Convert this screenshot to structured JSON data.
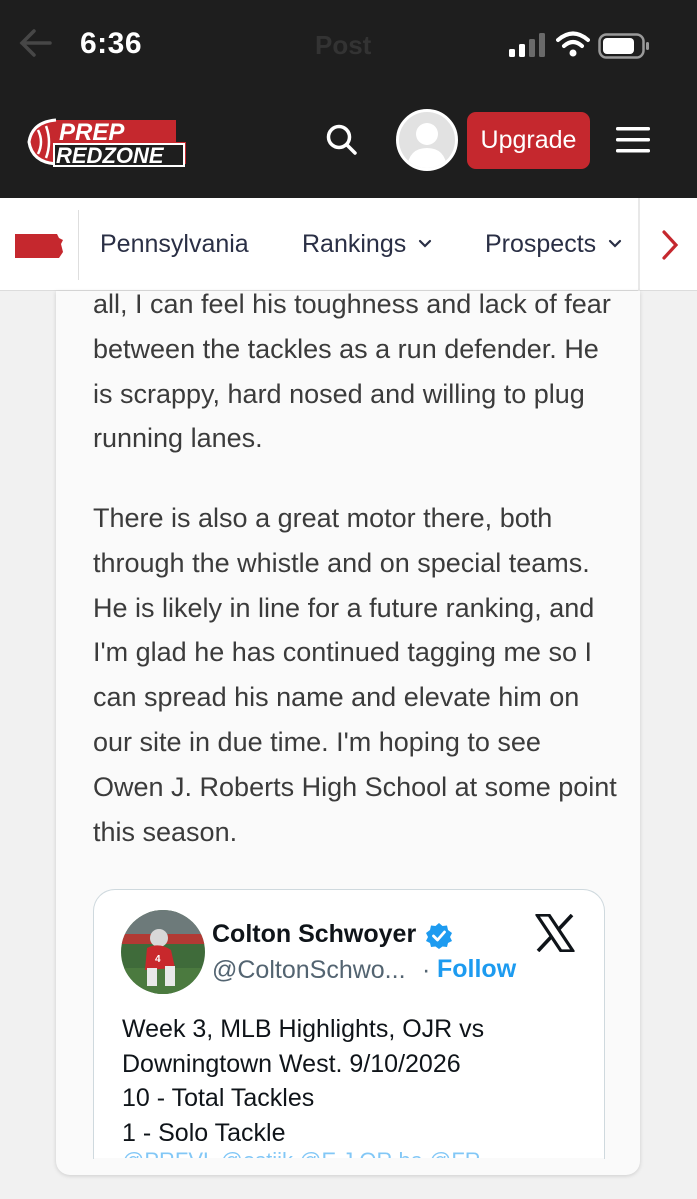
{
  "status_bar": {
    "time": "6:36",
    "ghost_title": "Post",
    "icons": [
      "back-arrow-icon",
      "cell-signal-icon",
      "wifi-icon",
      "battery-icon"
    ]
  },
  "header": {
    "logo_line1": "PREP",
    "logo_line2": "REDZONE",
    "upgrade_label": "Upgrade",
    "icons": [
      "search-icon",
      "avatar-icon",
      "hamburger-menu-icon"
    ],
    "colors": {
      "bg": "#1e1e1e",
      "brand_red": "#c5282e"
    }
  },
  "sub_nav": {
    "items": [
      {
        "label": "Pennsylvania"
      },
      {
        "label": "Rankings"
      },
      {
        "label": "Prospects"
      }
    ],
    "icons": [
      "pennsylvania-flag-icon",
      "chevron-down-icon",
      "chevron-right-icon"
    ]
  },
  "article": {
    "paragraph1": "all, I can feel his toughness and lack of fear between the tackles as a run defender. He is scrappy, hard nosed and willing to plug running lanes.",
    "paragraph2": "There is also a great motor there, both through the whistle and on special teams. He is likely in line for a future ranking, and I'm glad he has continued tagging me so I can spread his name and elevate him on our site in due time. I'm hoping to see Owen J. Roberts High School at some point this season."
  },
  "tweet": {
    "name": "Colton Schwoyer",
    "handle": "@ColtonSchwo...",
    "separator": "·",
    "follow_label": "Follow",
    "lines": [
      "Week 3, MLB Highlights, OJR vs",
      "Downingtown West. 9/10/2026",
      "10 - Total Tackles",
      "1 - Solo Tackle"
    ],
    "cut_line": "@PRFVL  @ostiik  @E.J.OR  ba  @FR",
    "icons": [
      "verified-badge-icon",
      "x-logo-icon"
    ],
    "colors": {
      "link": "#1d9bf0",
      "text": "#0f1419",
      "muted": "#536471"
    }
  }
}
